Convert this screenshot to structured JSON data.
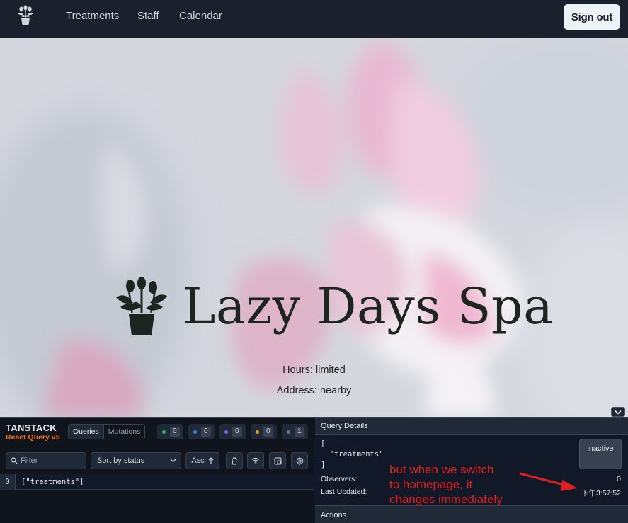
{
  "nav": {
    "links": [
      "Treatments",
      "Staff",
      "Calendar"
    ],
    "signout_label": "Sign out"
  },
  "hero": {
    "title": "Lazy Days Spa",
    "hours": "Hours: limited",
    "address": "Address: nearby"
  },
  "devtools": {
    "brand_top": "TANSTACK",
    "brand_sub": "React Query v5",
    "tabs": [
      "Queries",
      "Mutations"
    ],
    "active_tab": "Queries",
    "status_counts": [
      {
        "status": "fresh",
        "color": "#22c55e",
        "count": "0"
      },
      {
        "status": "fetching",
        "color": "#3b82f6",
        "count": "0"
      },
      {
        "status": "paused",
        "color": "#8b5cf6",
        "count": "0"
      },
      {
        "status": "stale",
        "color": "#f59e0b",
        "count": "0"
      },
      {
        "status": "inactive",
        "color": "#6b7280",
        "count": "1"
      }
    ],
    "filter_placeholder": "Filter",
    "sort_label": "Sort by status",
    "order_label": "Asc",
    "queries": [
      {
        "observers": "0",
        "key": "[\"treatments\"]"
      }
    ],
    "details": {
      "header": "Query Details",
      "key_open": "[",
      "key_item": "\"treatments\"",
      "key_close": "]",
      "status_badge": "inactive",
      "observers_label": "Observers:",
      "observers_value": "0",
      "updated_label": "Last Updated:",
      "updated_value": "下午3:57:52",
      "actions_header": "Actions"
    }
  },
  "annotation": {
    "lines": [
      "but when we switch",
      "to homepage, it",
      "changes immediately"
    ],
    "color": "#e02020"
  }
}
